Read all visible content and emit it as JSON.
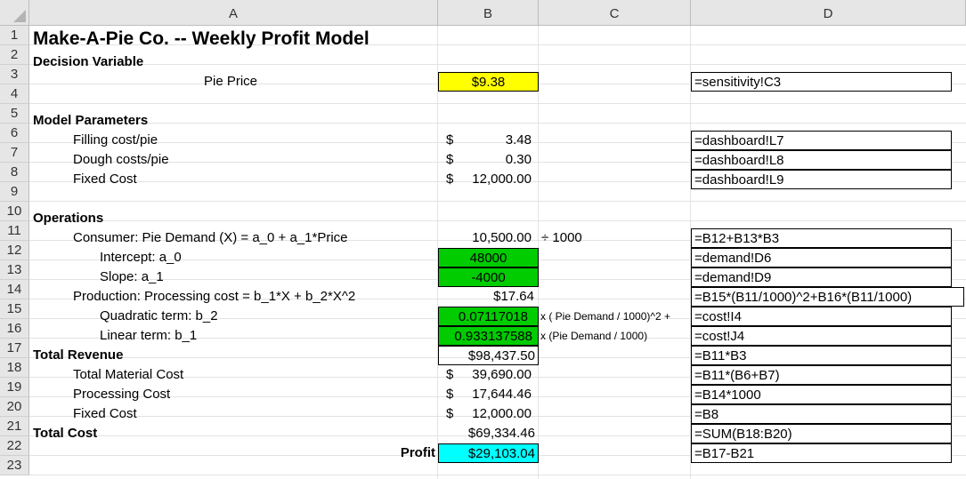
{
  "columns": [
    "A",
    "B",
    "C",
    "D"
  ],
  "rows": [
    "1",
    "2",
    "3",
    "4",
    "5",
    "6",
    "7",
    "8",
    "9",
    "10",
    "11",
    "12",
    "13",
    "14",
    "15",
    "16",
    "17",
    "18",
    "19",
    "20",
    "21",
    "22",
    "23"
  ],
  "title": "Make-A-Pie Co. -- Weekly Profit Model",
  "decision": {
    "header": "Decision Variable",
    "price_label": "Pie Price",
    "price_value": "$9.38",
    "price_formula": "=sensitivity!C3"
  },
  "params": {
    "header": "Model Parameters",
    "items": [
      {
        "label": "Filling cost/pie",
        "sym": "$",
        "value": "3.48",
        "formula": "=dashboard!L7"
      },
      {
        "label": "Dough costs/pie",
        "sym": "$",
        "value": "0.30",
        "formula": "=dashboard!L8"
      },
      {
        "label": "Fixed Cost",
        "sym": "$",
        "value": "12,000.00",
        "formula": "=dashboard!L9"
      }
    ]
  },
  "ops": {
    "header": "Operations",
    "demand_label": "Consumer:  Pie Demand (X) = a_0 + a_1*Price",
    "demand_value": "10,500.00",
    "demand_note": "÷ 1000",
    "demand_formula": "=B12+B13*B3",
    "intercept_label": "Intercept: a_0",
    "intercept_value": "48000",
    "intercept_formula": "=demand!D6",
    "slope_label": "Slope: a_1",
    "slope_value": "-4000",
    "slope_formula": "=demand!D9",
    "prod_label": "Production: Processing cost = b_1*X + b_2*X^2",
    "prod_value": "$17.64",
    "prod_formula": "=B15*(B11/1000)^2+B16*(B11/1000)",
    "quad_label": "Quadratic term: b_2",
    "quad_value": "0.07117018",
    "quad_note": "x ( Pie Demand / 1000)^2 +",
    "quad_formula": "=cost!I4",
    "lin_label": "Linear term: b_1",
    "lin_value": "0.933137588",
    "lin_note": "x (Pie Demand / 1000)",
    "lin_formula": "=cost!J4"
  },
  "revenue": {
    "label": "Total Revenue",
    "value": "$98,437.50",
    "formula": "=B11*B3"
  },
  "costs": [
    {
      "label": "Total Material Cost",
      "sym": "$",
      "value": "39,690.00",
      "formula": "=B11*(B6+B7)"
    },
    {
      "label": "Processing Cost",
      "sym": "$",
      "value": "17,644.46",
      "formula": "=B14*1000"
    },
    {
      "label": "Fixed Cost",
      "sym": "$",
      "value": "12,000.00",
      "formula": "=B8"
    }
  ],
  "total_cost": {
    "label": "Total Cost",
    "value": "$69,334.46",
    "formula": "=SUM(B18:B20)"
  },
  "profit": {
    "label": "Profit",
    "value": "$29,103.04",
    "formula": "=B17-B21"
  },
  "colors": {
    "yellow": "#ffff00",
    "green": "#00cc00",
    "cyan": "#00ffff"
  }
}
